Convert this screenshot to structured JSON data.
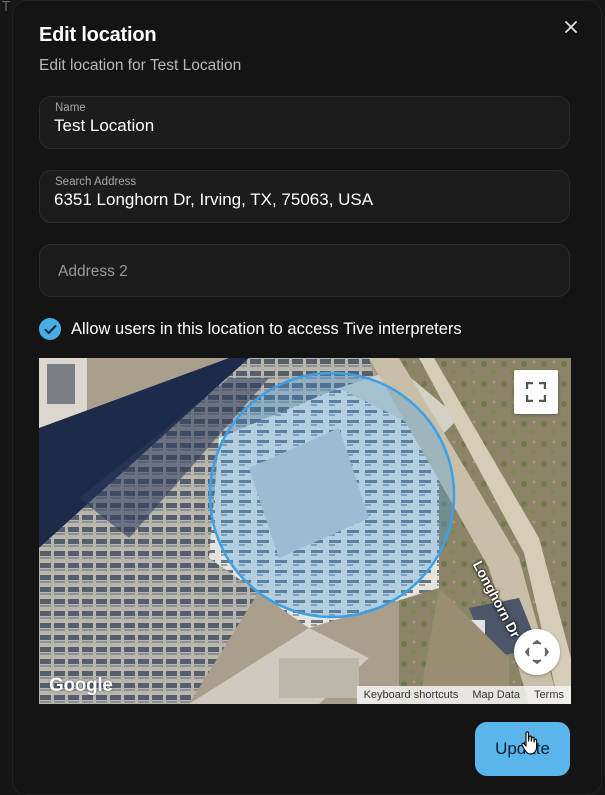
{
  "dialog": {
    "title": "Edit location",
    "subtitle": "Edit location for Test Location",
    "close_icon": "close-icon"
  },
  "fields": {
    "name": {
      "label": "Name",
      "value": "Test Location"
    },
    "search_address": {
      "label": "Search Address",
      "value": "6351 Longhorn Dr, Irving, TX, 75063, USA"
    },
    "address2": {
      "placeholder": "Address 2"
    }
  },
  "checkbox": {
    "checked": true,
    "label": "Allow users in this location to access Tive interpreters",
    "color": "#4aaee6"
  },
  "map": {
    "type": "satellite",
    "road_label": "Longhorn Dr",
    "logo": "Google",
    "attribution": [
      "Keyboard shortcuts",
      "Map Data",
      "Terms"
    ],
    "fullscreen_icon": "fullscreen-icon",
    "pan_icon": "pan-icon",
    "radius_color": "#3aa0e8"
  },
  "actions": {
    "update_label": "Update",
    "accent": "#5ab6ea"
  }
}
